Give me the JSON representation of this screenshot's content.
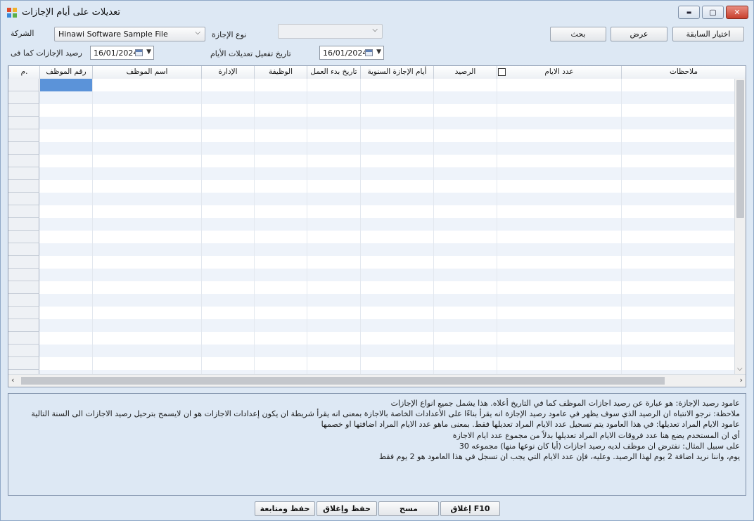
{
  "window": {
    "title": "تعديلات على أيام الإجازات",
    "controls": {
      "minimize": "▬",
      "maximize": "▢",
      "close": "✕"
    }
  },
  "filters": {
    "company_label": "الشركة",
    "company_value": "Hinawi Software Sample File",
    "leave_type_label": "نوع الإجازة",
    "leave_type_value": "",
    "balance_as_of_label": "رصيد الإجازات كما فى",
    "balance_as_of_date": "16/01/2024",
    "activation_date_label": "تاريخ تفعيل تعديلات الأيام",
    "activation_date": "16/01/2024"
  },
  "actions": {
    "prev_selection": "اختيار السابقة",
    "show": "عرض",
    "search": "بحث"
  },
  "grid": {
    "columns": [
      {
        "key": "no",
        "label": ".م"
      },
      {
        "key": "emp_no",
        "label": "رقم الموظف"
      },
      {
        "key": "emp_name",
        "label": "اسم الموظف"
      },
      {
        "key": "dept",
        "label": "الإدارة"
      },
      {
        "key": "job",
        "label": "الوظيفة"
      },
      {
        "key": "start_date",
        "label": "تاريخ بدء العمل"
      },
      {
        "key": "annual_days",
        "label": "أيام الإجازة السنوية"
      },
      {
        "key": "balance",
        "label": "الرصيد"
      },
      {
        "key": "days",
        "label": "عدد الايام"
      },
      {
        "key": "notes",
        "label": "ملاحظات"
      }
    ]
  },
  "notes": [
    "عامود رصيد الإجازة: هو عبارة عن رصيد اجازات الموظف كما في التاريخ أعلاه. هذا يشمل جميع انواع الإجازات",
    "ملاحظة: نرجو الانتباه ان الرصيد الذي سوف يظهر في عامود رصيد الإجازة انه يقرأ بناءًا على الأعدادات الخاصة بالاجازة بمعنى انه يقرأ شريطة ان يكون إعدادات الاجازات هو ان لايسمح بترحيل رصيد الاجازات الى السنة التالية",
    "عامود الايام المراد تعديلها: في هذا العامود يتم تسجيل عدد الايام المراد تعديلها فقط. بمعنى  ماهو عدد الايام المراد اضافتها او خصمها",
    "أي ان المستخدم يضع هنا عدد فروقات الايام المراد تعديلها بدلاً من مجموع عدد ايام الاجازة",
    "على سبيل المثال: نفترض ان موظف لديه رصيد اجازات (أيا كان نوعها منها) مجموعه 30",
    "يوم، واننا نريد اضافة 2 يوم لهذا الرصيد. وعليه، فإن عدد الايام التي يجب ان تسجل في هذا العامود هو 2 يوم فقط"
  ],
  "footer": {
    "close": "F10 إغلاق",
    "clear": "مسح",
    "save_close": "حفظ وإغلاق",
    "save_continue": "حفظ ومتابعة"
  }
}
